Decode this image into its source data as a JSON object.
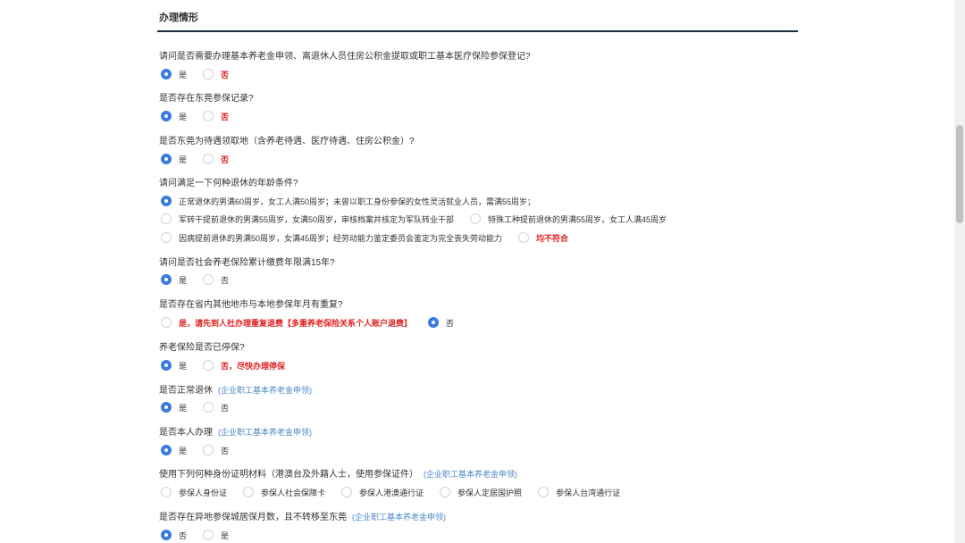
{
  "section_title": "办理情形",
  "tag_text": "(企业职工基本养老金申领)",
  "questions": [
    {
      "text": "请问是否需要办理基本养老金申领、离退休人员住房公积金提取或职工基本医疗保险参保登记?",
      "options": [
        {
          "label": "是",
          "selected": true,
          "red": false
        },
        {
          "label": "否",
          "selected": false,
          "red": true
        }
      ]
    },
    {
      "text": "是否存在东莞参保记录?",
      "options": [
        {
          "label": "是",
          "selected": true,
          "red": false
        },
        {
          "label": "否",
          "selected": false,
          "red": true
        }
      ]
    },
    {
      "text": "是否东莞为待遇领取地（含养老待遇、医疗待遇、住房公积金）?",
      "options": [
        {
          "label": "是",
          "selected": true,
          "red": false
        },
        {
          "label": "否",
          "selected": false,
          "red": true
        }
      ]
    },
    {
      "text": "请问满足一下何种退休的年龄条件?",
      "options": [
        {
          "label": "正常退休的男满60周岁，女工人满50周岁；未曾以职工身份参保的女性灵活就业人员，需满55周岁；",
          "selected": true,
          "red": false
        },
        {
          "label": "军转干提前退休的男满55周岁，女满50周岁，审核档案并核定为军队转业干部",
          "selected": false,
          "red": false
        },
        {
          "label": "特殊工种提前退休的男满55周岁，女工人满45周岁",
          "selected": false,
          "red": false
        },
        {
          "label": "因病提前退休的男满50周岁，女满45周岁；经劳动能力鉴定委员会鉴定为完全丧失劳动能力",
          "selected": false,
          "red": false
        },
        {
          "label": "均不符合",
          "selected": false,
          "red": true
        }
      ]
    },
    {
      "text": "请问是否社会养老保险累计缴费年限满15年?",
      "options": [
        {
          "label": "是",
          "selected": true,
          "red": false
        },
        {
          "label": "否",
          "selected": false,
          "red": false
        }
      ]
    },
    {
      "text": "是否存在省内其他地市与本地参保年月有重复?",
      "options": [
        {
          "label": "是，请先到人社办理重复退费【多重养老保险关系个人账户退费】",
          "selected": false,
          "red": true
        },
        {
          "label": "否",
          "selected": true,
          "red": false
        }
      ]
    },
    {
      "text": "养老保险是否已停保?",
      "options": [
        {
          "label": "是",
          "selected": true,
          "red": false
        },
        {
          "label": "否，尽快办理停保",
          "selected": false,
          "red": true
        }
      ]
    },
    {
      "text": "是否正常退休",
      "options": [
        {
          "label": "是",
          "selected": true,
          "red": false
        },
        {
          "label": "否",
          "selected": false,
          "red": false
        }
      ]
    },
    {
      "text": "是否本人办理",
      "options": [
        {
          "label": "是",
          "selected": true,
          "red": false
        },
        {
          "label": "否",
          "selected": false,
          "red": false
        }
      ]
    },
    {
      "text": "使用下列何种身份证明材料（港澳台及外籍人士，使用参保证件）",
      "options": [
        {
          "label": "参保人身份证",
          "selected": false,
          "red": false
        },
        {
          "label": "参保人社会保障卡",
          "selected": false,
          "red": false
        },
        {
          "label": "参保人港澳通行证",
          "selected": false,
          "red": false
        },
        {
          "label": "参保人定居国护照",
          "selected": false,
          "red": false
        },
        {
          "label": "参保人台湾通行证",
          "selected": false,
          "red": false
        }
      ]
    },
    {
      "text": "是否存在异地参保城居保月数，且不转移至东莞",
      "options": [
        {
          "label": "否",
          "selected": true,
          "red": false
        },
        {
          "label": "是",
          "selected": false,
          "red": false
        }
      ]
    }
  ]
}
